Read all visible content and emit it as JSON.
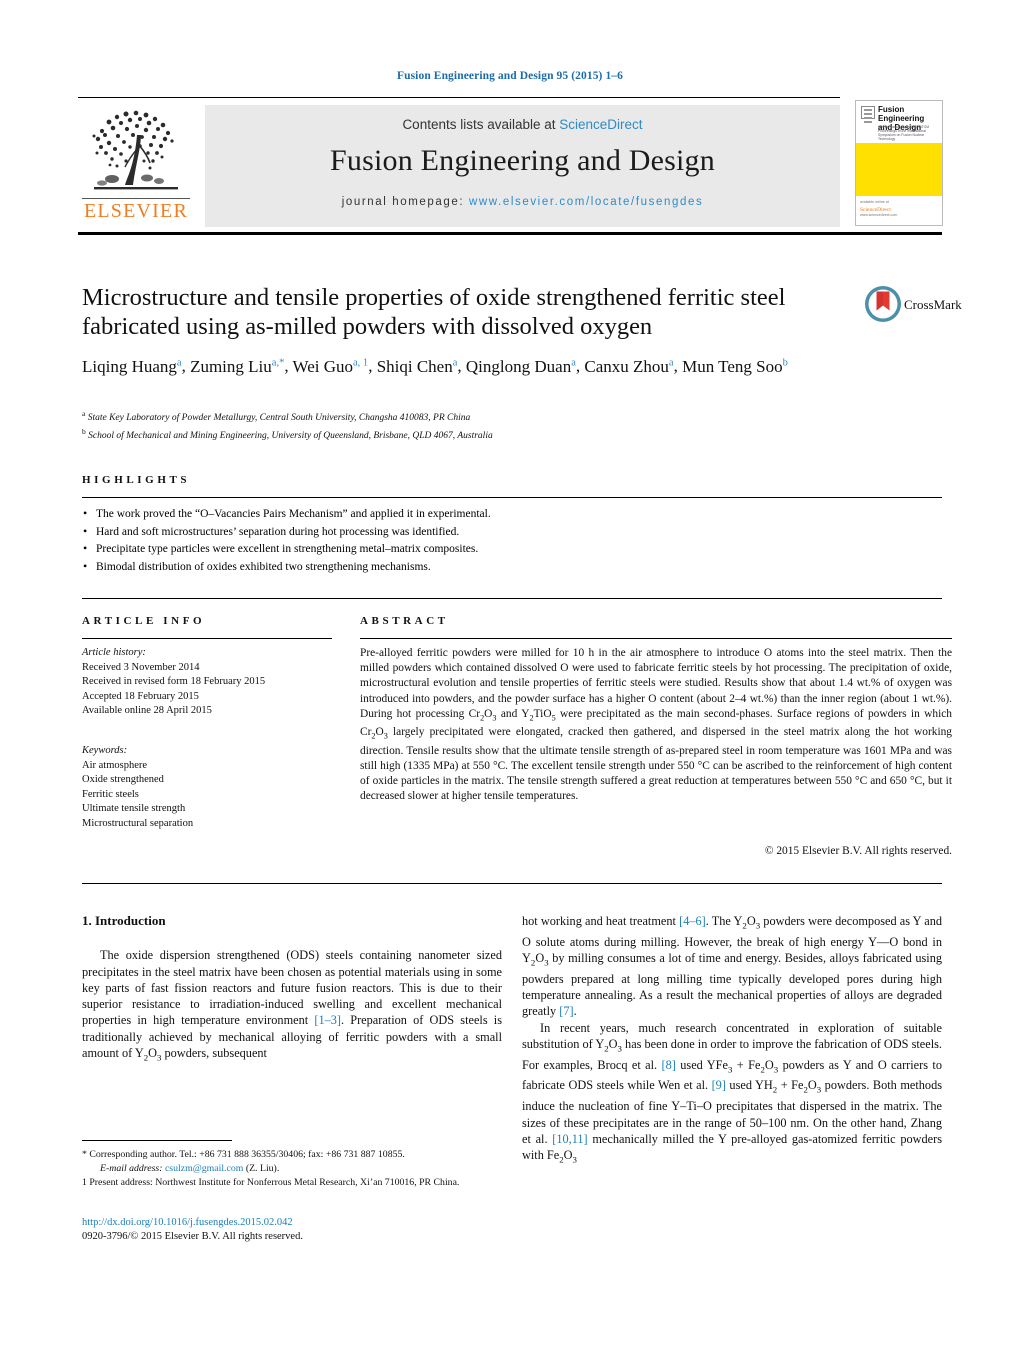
{
  "running_head": "Fusion Engineering and Design 95 (2015) 1–6",
  "header": {
    "contents_prefix": "Contents lists available at ",
    "sciencedirect": "ScienceDirect",
    "journal_name": "Fusion Engineering and Design",
    "homepage_label": "journal homepage: ",
    "homepage_url": "www.elsevier.com/locate/fusengdes",
    "publisher": "ELSEVIER",
    "cover": {
      "title": "Fusion Engineering and Design",
      "subtitle": "with the Association of\nEURATOM\nProceedings of the International Symposium on Fusion Nuclear Technology",
      "footer_note": "available online at",
      "footer_brand": "ScienceDirect",
      "footer_url": "www.sciencedirect.com",
      "accent_color": "#ffe000"
    }
  },
  "article": {
    "title": "Microstructure and tensile properties of oxide strengthened ferritic steel fabricated using as-milled powders with dissolved oxygen",
    "authors": [
      {
        "name": "Liqing Huang",
        "marks": "a"
      },
      {
        "name": "Zuming Liu",
        "marks": "a,*"
      },
      {
        "name": "Wei Guo",
        "marks": "a, 1"
      },
      {
        "name": "Shiqi Chen",
        "marks": "a"
      },
      {
        "name": "Qinglong Duan",
        "marks": "a"
      },
      {
        "name": "Canxu Zhou",
        "marks": "a"
      },
      {
        "name": "Mun Teng Soo",
        "marks": "b"
      }
    ],
    "affiliations": [
      {
        "mark": "a",
        "text": "State Key Laboratory of Powder Metallurgy, Central South University, Changsha 410083, PR China"
      },
      {
        "mark": "b",
        "text": "School of Mechanical and Mining Engineering, University of Queensland, Brisbane, QLD 4067, Australia"
      }
    ],
    "crossmark_label": "CrossMark"
  },
  "highlights": {
    "heading": "HIGHLIGHTS",
    "items": [
      "The work proved the “O–Vacancies Pairs Mechanism” and applied it in experimental.",
      "Hard and soft microstructures’ separation during hot processing was identified.",
      "Precipitate type particles were excellent in strengthening metal–matrix composites.",
      "Bimodal distribution of oxides exhibited two strengthening mechanisms."
    ]
  },
  "article_info": {
    "heading": "ARTICLE INFO",
    "history_label": "Article history:",
    "history": [
      "Received 3 November 2014",
      "Received in revised form 18 February 2015",
      "Accepted 18 February 2015",
      "Available online 28 April 2015"
    ],
    "keywords_label": "Keywords:",
    "keywords": [
      "Air atmosphere",
      "Oxide strengthened",
      "Ferritic steels",
      "Ultimate tensile strength",
      "Microstructural separation"
    ]
  },
  "abstract": {
    "heading": "ABSTRACT",
    "text_part1": "Pre-alloyed ferritic powders were milled for 10 h in the air atmosphere to introduce O atoms into the steel matrix. Then the milled powders which contained dissolved O were used to fabricate ferritic steels by hot processing. The precipitation of oxide, microstructural evolution and tensile properties of ferritic steels were studied. Results show that about 1.4 wt.% of oxygen was introduced into powders, and the powder surface has a higher O content (about 2–4 wt.%) than the inner region (about 1 wt.%). During hot processing Cr",
    "f1_sub": "2",
    "f1_mid": "O",
    "f1_sub2": "3",
    "text_part2": " and Y",
    "f2_sub": "2",
    "f2_mid": "TiO",
    "f2_sub2": "5",
    "text_part3": " were precipitated as the main second-phases. Surface regions of powders in which Cr",
    "text_part4": " largely precipitated were elongated, cracked then gathered, and dispersed in the steel matrix along the hot working direction. Tensile results show that the ultimate tensile strength of as-prepared steel in room temperature was 1601 MPa and was still high (1335 MPa) at 550 °C. The excellent tensile strength under 550 °C can be ascribed to the reinforcement of high content of oxide particles in the matrix. The tensile strength suffered a great reduction at temperatures between 550 °C and 650 °C, but it decreased slower at higher tensile temperatures.",
    "copyright": "© 2015 Elsevier B.V. All rights reserved."
  },
  "body": {
    "section_number_title": "1.  Introduction",
    "left_p1_a": "The oxide dispersion strengthened (ODS) steels containing nanometer sized precipitates in the steel matrix have been chosen as potential materials using in some key parts of fast fission reactors and future fusion reactors. This is due to their superior resistance to irradiation-induced swelling and excellent mechanical properties in high temperature environment ",
    "left_ref1": "[1–3]",
    "left_p1_b": ". Preparation of ODS steels is traditionally achieved by mechanical alloying of ferritic powders with a small amount of Y",
    "left_p1_c": " powders, subsequent",
    "right_p1_a": "hot working and heat treatment ",
    "right_ref1": "[4–6]",
    "right_p1_b": ". The Y",
    "right_p1_c": " powders were decomposed as Y and O solute atoms during milling. However, the break of high energy Y—O bond in Y",
    "right_p1_d": " by milling consumes a lot of time and energy. Besides, alloys fabricated using powders prepared at long milling time typically developed pores during high temperature annealing. As a result the mechanical properties of alloys are degraded greatly ",
    "right_ref2": "[7]",
    "right_p1_e": ".",
    "right_p2_a": "In recent years, much research concentrated in exploration of suitable substitution of Y",
    "right_p2_b": " has been done in order to improve the fabrication of ODS steels. For examples, Brocq et al. ",
    "right_ref3": "[8]",
    "right_p2_c": " used YFe",
    "right_p2_d": " + Fe",
    "right_p2_e": " powders as Y and O carriers to fabricate ODS steels while Wen et al. ",
    "right_ref4": "[9]",
    "right_p2_f": " used YH",
    "right_p2_g": " + Fe",
    "right_p2_h": " powders. Both methods induce the nucleation of fine Y–Ti–O precipitates that dispersed in the matrix. The sizes of these precipitates are in the range of 50–100 nm. On the other hand, Zhang et al. ",
    "right_ref5": "[10,11]",
    "right_p2_i": " mechanically milled the Y pre-alloyed gas-atomized ferritic powders with Fe",
    "right_p2_j": ""
  },
  "footnotes": {
    "corresponding": "* Corresponding author. Tel.: +86 731 888 36355/30406; fax: +86 731 887 10855.",
    "email_label": "E-mail address:",
    "email": "csulzm@gmail.com",
    "email_person": "(Z. Liu).",
    "present_address": "1 Present address: Northwest Institute for Nonferrous Metal Research, Xi’an 710016, PR China."
  },
  "footer": {
    "doi_url": "http://dx.doi.org/10.1016/j.fusengdes.2015.02.042",
    "issn_line": "0920-3796/© 2015 Elsevier B.V. All rights reserved."
  }
}
